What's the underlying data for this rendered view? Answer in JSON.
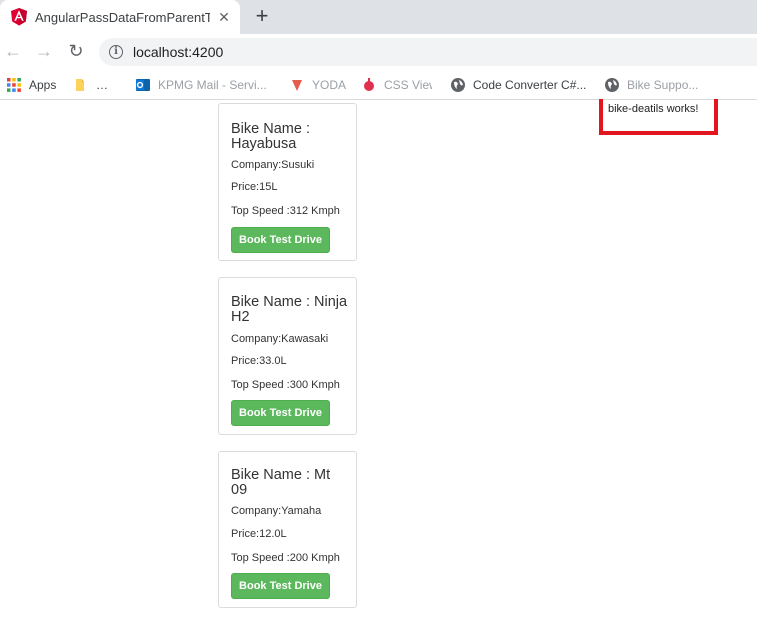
{
  "browser": {
    "tab": {
      "title": "AngularPassDataFromParentToCh",
      "favicon": "angular-logo",
      "close_glyph": "✕"
    },
    "new_tab_glyph": "+",
    "nav": {
      "back": "←",
      "forward": "→",
      "reload": "↻"
    },
    "address": {
      "info_glyph": "i",
      "url": "localhost:4200"
    },
    "bookmarks": [
      {
        "label": "Apps",
        "icon": "apps-grid-icon"
      },
      {
        "label": "…",
        "icon": "folder-icon"
      },
      {
        "label": "KPMG Mail - Servi...",
        "icon": "outlook-icon"
      },
      {
        "label": "YODA",
        "icon": "bookmark-icon"
      },
      {
        "label": "CSS View",
        "icon": "bookmark-icon"
      },
      {
        "label": "Code Converter C#...",
        "icon": "globe-icon"
      },
      {
        "label": "Bike Suppo...",
        "icon": "globe-icon"
      }
    ]
  },
  "bikes": [
    {
      "title": "Bike Name : Hayabusa",
      "company": "Company:Susuki",
      "price": "Price:15L",
      "speed": "Top Speed :312 Kmph",
      "button": "Book Test Drive"
    },
    {
      "title": "Bike Name : Ninja H2",
      "company": "Company:Kawasaki",
      "price": "Price:33.0L",
      "speed": "Top Speed :300 Kmph",
      "button": "Book Test Drive"
    },
    {
      "title": "Bike Name : Mt 09",
      "company": "Company:Yamaha",
      "price": "Price:12.0L",
      "speed": "Top Speed :200 Kmph",
      "button": "Book Test Drive"
    }
  ],
  "detail_component": {
    "text": "bike-deatils works!",
    "highlight_color": "#e3161f"
  },
  "colors": {
    "button": "#5cb85c",
    "tabstrip": "#dee1e6"
  }
}
